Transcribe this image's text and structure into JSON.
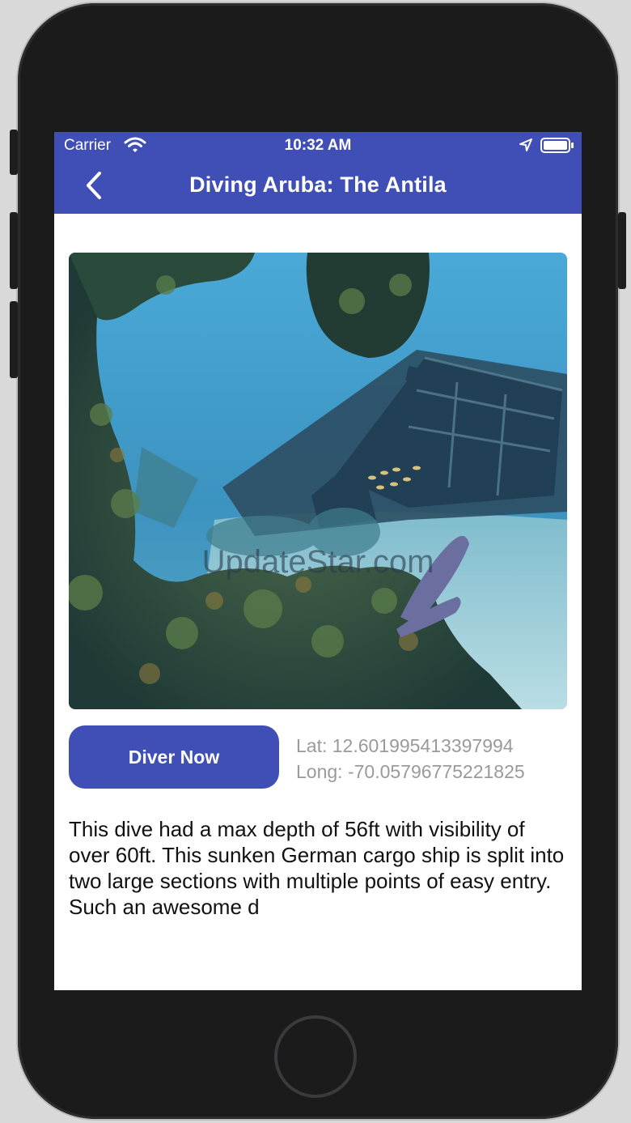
{
  "status_bar": {
    "carrier": "Carrier",
    "time": "10:32 AM",
    "wifi_icon": "wifi-icon",
    "location_icon": "location-arrow-icon",
    "battery_icon": "battery-icon"
  },
  "nav": {
    "back_icon": "chevron-left-icon",
    "title": "Diving Aruba: The Antila",
    "background": "#3f4fb5"
  },
  "photo": {
    "watermark": "UpdateStar.com"
  },
  "actions": {
    "dive_button_label": "Diver Now"
  },
  "location": {
    "lat": "Lat: 12.601995413397994",
    "long": "Long: -70.05796775221825"
  },
  "description": "This dive had a max depth of 56ft with visibility of over 60ft. This sunken German cargo ship is split into two large sections with multiple points of easy entry. Such an awesome d"
}
